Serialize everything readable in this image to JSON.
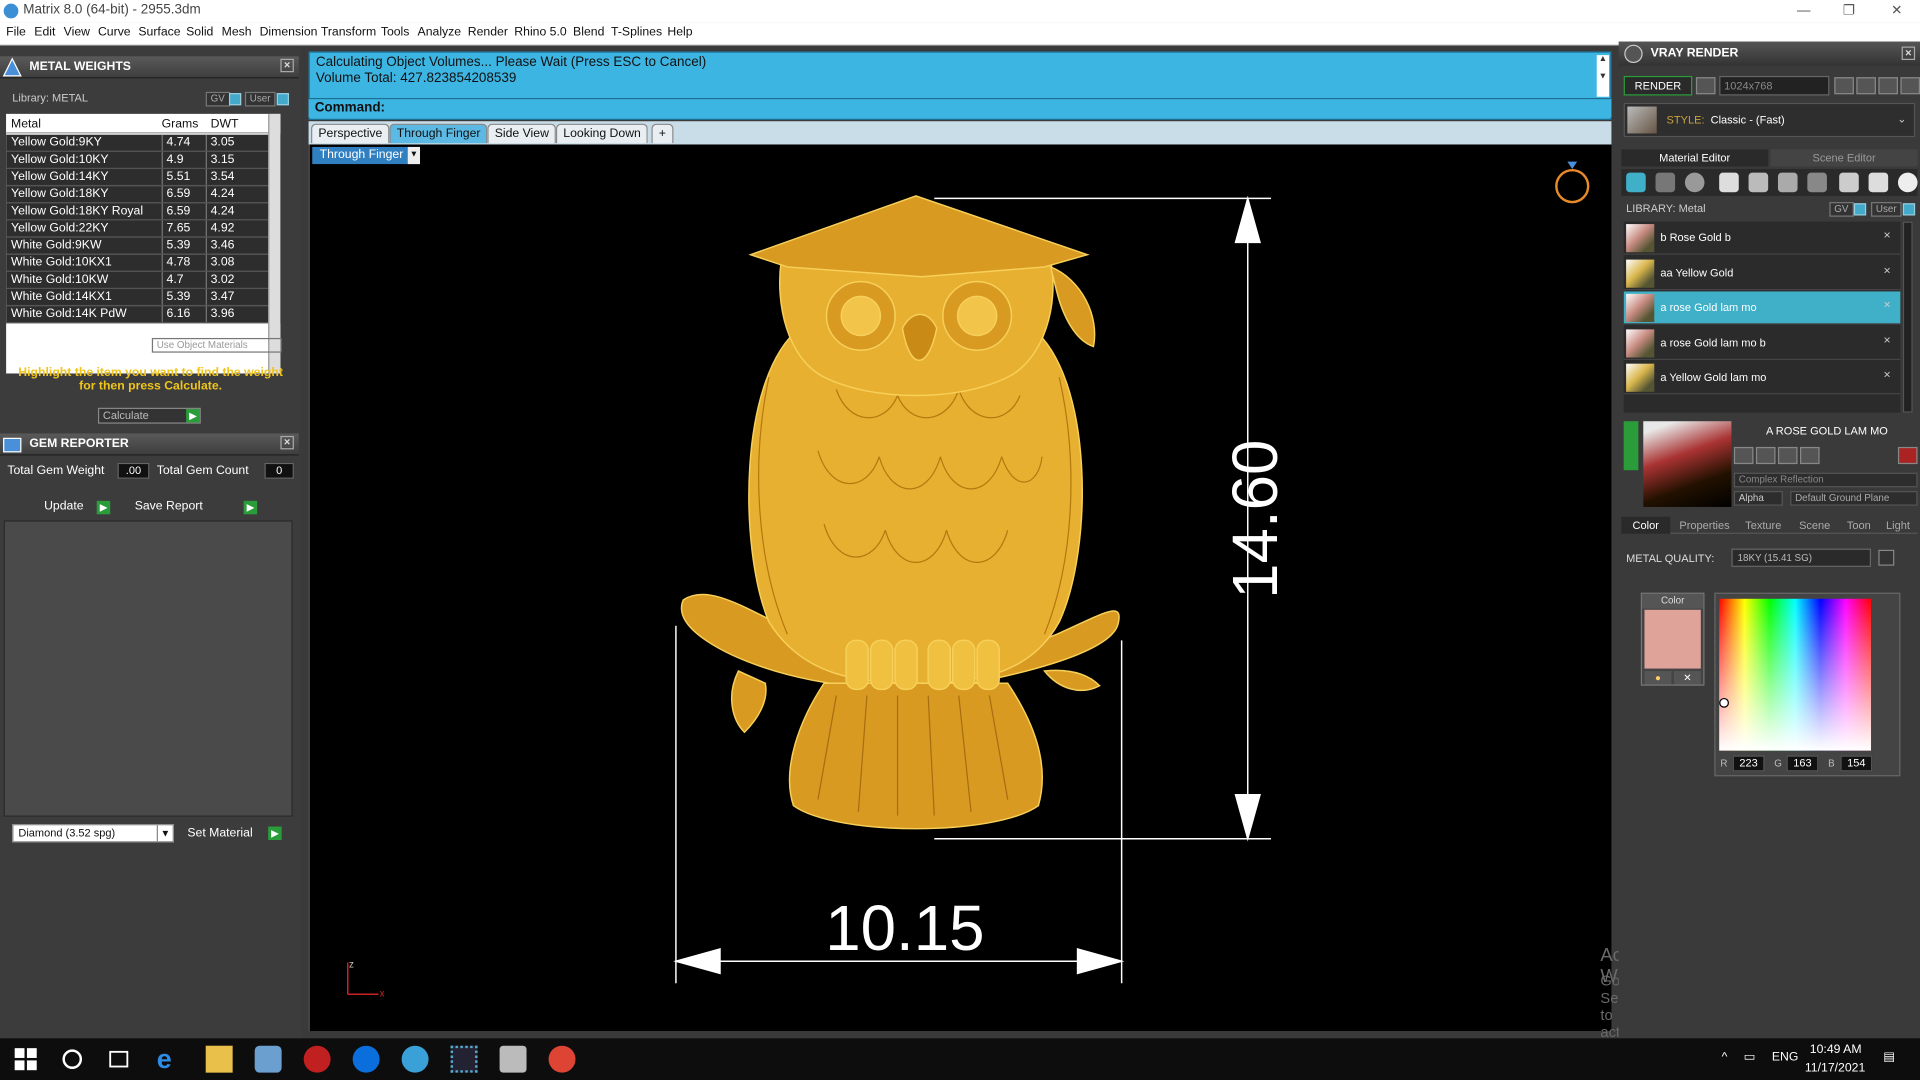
{
  "window": {
    "title": "Matrix 8.0 (64-bit) - 2955.3dm",
    "minimize": "—",
    "maximize": "❐",
    "close": "✕"
  },
  "menu": [
    "File",
    "Edit",
    "View",
    "Curve",
    "Surface",
    "Solid",
    "Mesh",
    "Dimension",
    "Transform",
    "Tools",
    "Analyze",
    "Render",
    "Rhino 5.0",
    "Blend",
    "T-Splines",
    "Help"
  ],
  "metal_weights": {
    "title": "METAL WEIGHTS",
    "library": "Library: METAL",
    "gv": "GV",
    "user": "User",
    "headers": [
      "Metal",
      "Grams",
      "DWT"
    ],
    "rows": [
      [
        "Yellow Gold:9KY",
        "4.74",
        "3.05"
      ],
      [
        "Yellow Gold:10KY",
        "4.9",
        "3.15"
      ],
      [
        "Yellow Gold:14KY",
        "5.51",
        "3.54"
      ],
      [
        "Yellow Gold:18KY",
        "6.59",
        "4.24"
      ],
      [
        "Yellow Gold:18KY Royal",
        "6.59",
        "4.24"
      ],
      [
        "Yellow Gold:22KY",
        "7.65",
        "4.92"
      ],
      [
        "White Gold:9KW",
        "5.39",
        "3.46"
      ],
      [
        "White Gold:10KX1",
        "4.78",
        "3.08"
      ],
      [
        "White Gold:10KW",
        "4.7",
        "3.02"
      ],
      [
        "White Gold:14KX1",
        "5.39",
        "3.47"
      ],
      [
        "White Gold:14K PdW",
        "6.16",
        "3.96"
      ]
    ],
    "use_object_materials": "Use Object Materials",
    "hint": "Highlight the item you want to find the weight for then press Calculate.",
    "calculate": "Calculate"
  },
  "gem_reporter": {
    "title": "GEM REPORTER",
    "total_weight_label": "Total Gem Weight",
    "total_weight": ".00",
    "total_count_label": "Total Gem Count",
    "total_count": "0",
    "update": "Update",
    "save_report": "Save Report",
    "gem_select": "Diamond    (3.52 spg)",
    "set_material": "Set Material"
  },
  "command": {
    "line1": "Calculating Object Volumes... Please Wait (Press ESC to Cancel)",
    "line2": "Volume Total: 427.823854208539",
    "label": "Command:"
  },
  "viewport": {
    "tabs": [
      "Perspective",
      "Through Finger",
      "Side View",
      "Looking Down"
    ],
    "active_tab": "Through Finger",
    "view_name": "Through Finger",
    "dim_height": "14.60",
    "dim_width": "10.15",
    "axis_z": "z",
    "axis_x": "x",
    "watermark1": "Activate Windows",
    "watermark2": "Go to Settings to activate Windows.",
    "object_color": "#e8b030"
  },
  "vray": {
    "title": "VRAY RENDER",
    "render": "RENDER",
    "resolution": "1024x768",
    "style_label": "STYLE:",
    "style_value": "Classic - (Fast)",
    "tabs": [
      "Material Editor",
      "Scene Editor"
    ],
    "library": "LIBRARY: Metal",
    "gv": "GV",
    "user": "User",
    "materials": [
      {
        "name": "b Rose Gold b",
        "tone": "rose"
      },
      {
        "name": "aa Yellow Gold",
        "tone": "yellow"
      },
      {
        "name": "a rose Gold lam mo",
        "tone": "rose",
        "selected": true
      },
      {
        "name": "a rose Gold lam mo b",
        "tone": "rose"
      },
      {
        "name": "a Yellow Gold lam mo",
        "tone": "yellow"
      }
    ],
    "preview_name": "A ROSE GOLD LAM MO",
    "reflection": "Complex Reflection",
    "alpha": "Alpha",
    "ground": "Default Ground Plane",
    "prop_tabs": [
      "Color",
      "Properties",
      "Texture",
      "Scene",
      "Toon",
      "Light"
    ],
    "metal_quality_label": "METAL QUALITY:",
    "metal_quality": "18KY           (15.41 SG)",
    "color_label": "Color",
    "r_label": "R",
    "r": "223",
    "g_label": "G",
    "g": "163",
    "b_label": "B",
    "b": "154",
    "swatch_color": "#dfa39a"
  },
  "taskbar": {
    "lang": "ENG",
    "time": "10:49 AM",
    "date": "11/17/2021"
  }
}
